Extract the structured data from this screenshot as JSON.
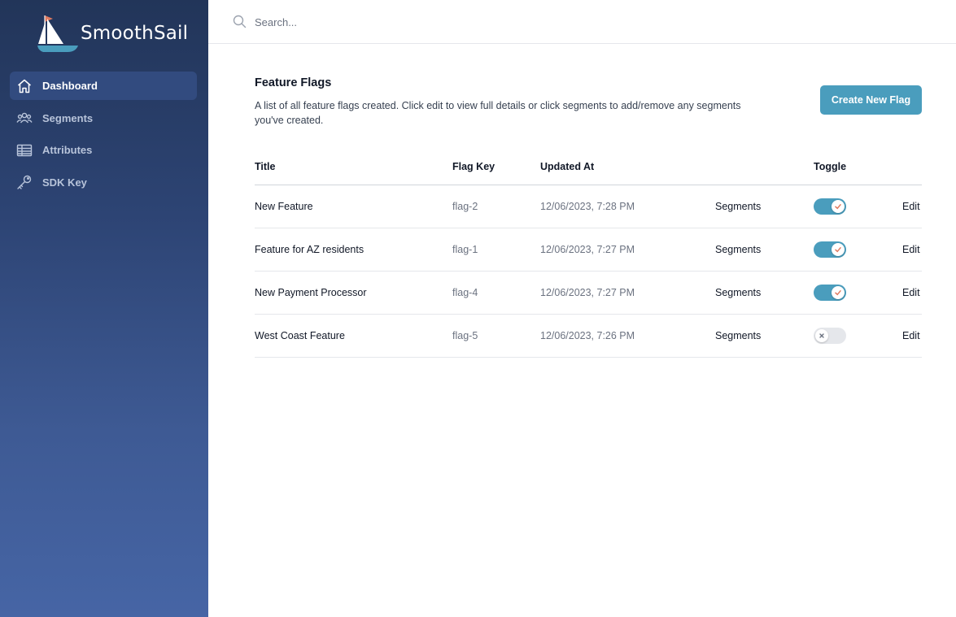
{
  "app": {
    "name": "SmoothSail"
  },
  "sidebar": {
    "items": [
      {
        "label": "Dashboard",
        "icon": "home-icon",
        "active": true
      },
      {
        "label": "Segments",
        "icon": "users-icon",
        "active": false
      },
      {
        "label": "Attributes",
        "icon": "table-icon",
        "active": false
      },
      {
        "label": "SDK Key",
        "icon": "key-icon",
        "active": false
      }
    ]
  },
  "search": {
    "placeholder": "Search...",
    "value": ""
  },
  "page": {
    "title": "Feature Flags",
    "description": "A list of all feature flags created. Click edit to view full details or click segments to add/remove any segments you've created.",
    "create_button": "Create New Flag"
  },
  "table": {
    "headers": {
      "title": "Title",
      "flag_key": "Flag Key",
      "updated_at": "Updated At",
      "toggle": "Toggle"
    },
    "rows": [
      {
        "title": "New Feature",
        "flag_key": "flag-2",
        "updated_at": "12/06/2023, 7:28 PM",
        "segments": "Segments",
        "toggle_on": true,
        "edit": "Edit"
      },
      {
        "title": "Feature for AZ residents",
        "flag_key": "flag-1",
        "updated_at": "12/06/2023, 7:27 PM",
        "segments": "Segments",
        "toggle_on": true,
        "edit": "Edit"
      },
      {
        "title": "New Payment Processor",
        "flag_key": "flag-4",
        "updated_at": "12/06/2023, 7:27 PM",
        "segments": "Segments",
        "toggle_on": true,
        "edit": "Edit"
      },
      {
        "title": "West Coast Feature",
        "flag_key": "flag-5",
        "updated_at": "12/06/2023, 7:26 PM",
        "segments": "Segments",
        "toggle_on": false,
        "edit": "Edit"
      }
    ]
  },
  "colors": {
    "accent": "#4a9dbd",
    "sidebar_top": "#223559",
    "sidebar_bottom": "#4665a5",
    "check": "#e07a5f"
  }
}
